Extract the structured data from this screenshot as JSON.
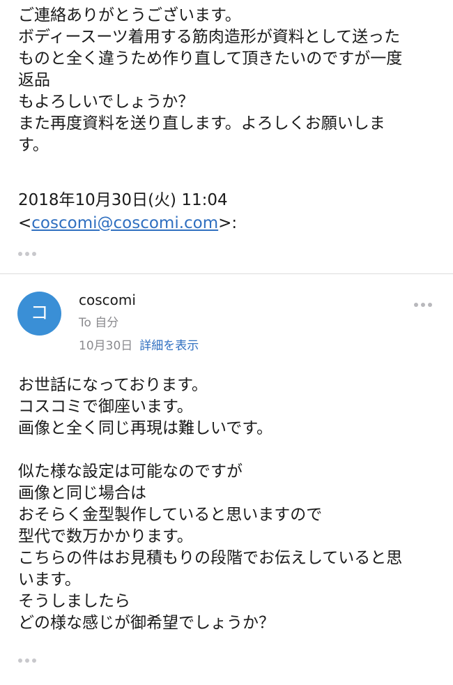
{
  "quoted_message": {
    "lines": [
      "ご連絡ありがとうございます。",
      "ボディースーツ着用する筋肉造形が資料として送った",
      "ものと全く違うため作り直して頂きたいのですが一度",
      "返品",
      "もよろしいでしょうか？",
      "また再度資料を送り直します。よろしくお願いしま",
      "す。"
    ],
    "date_line": "2018年10月30日(火) 11:04",
    "email_prefix": "<",
    "email": "coscomi@coscomi.com",
    "email_suffix": ">:"
  },
  "message": {
    "avatar_letter": "コ",
    "sender": "coscomi",
    "recipient": "To 自分",
    "date": "10月30日",
    "details_link": "詳細を表示",
    "body_paragraph_1": [
      "お世話になっております。",
      "コスコミで御座います。",
      "画像と全く同じ再現は難しいです。"
    ],
    "body_paragraph_2": [
      "似た様な設定は可能なのですが",
      "画像と同じ場合は",
      "おそらく金型製作していると思いますので",
      "型代で数万かかります。",
      "こちらの件はお見積もりの段階でお伝えしていると思",
      "います。",
      "そうしましたら",
      "どの様な感じが御希望でしょうか？"
    ]
  },
  "colors": {
    "avatar_background": "#3a8fd6",
    "link": "#2f6fc0",
    "secondary_text": "#8a8a8e"
  }
}
